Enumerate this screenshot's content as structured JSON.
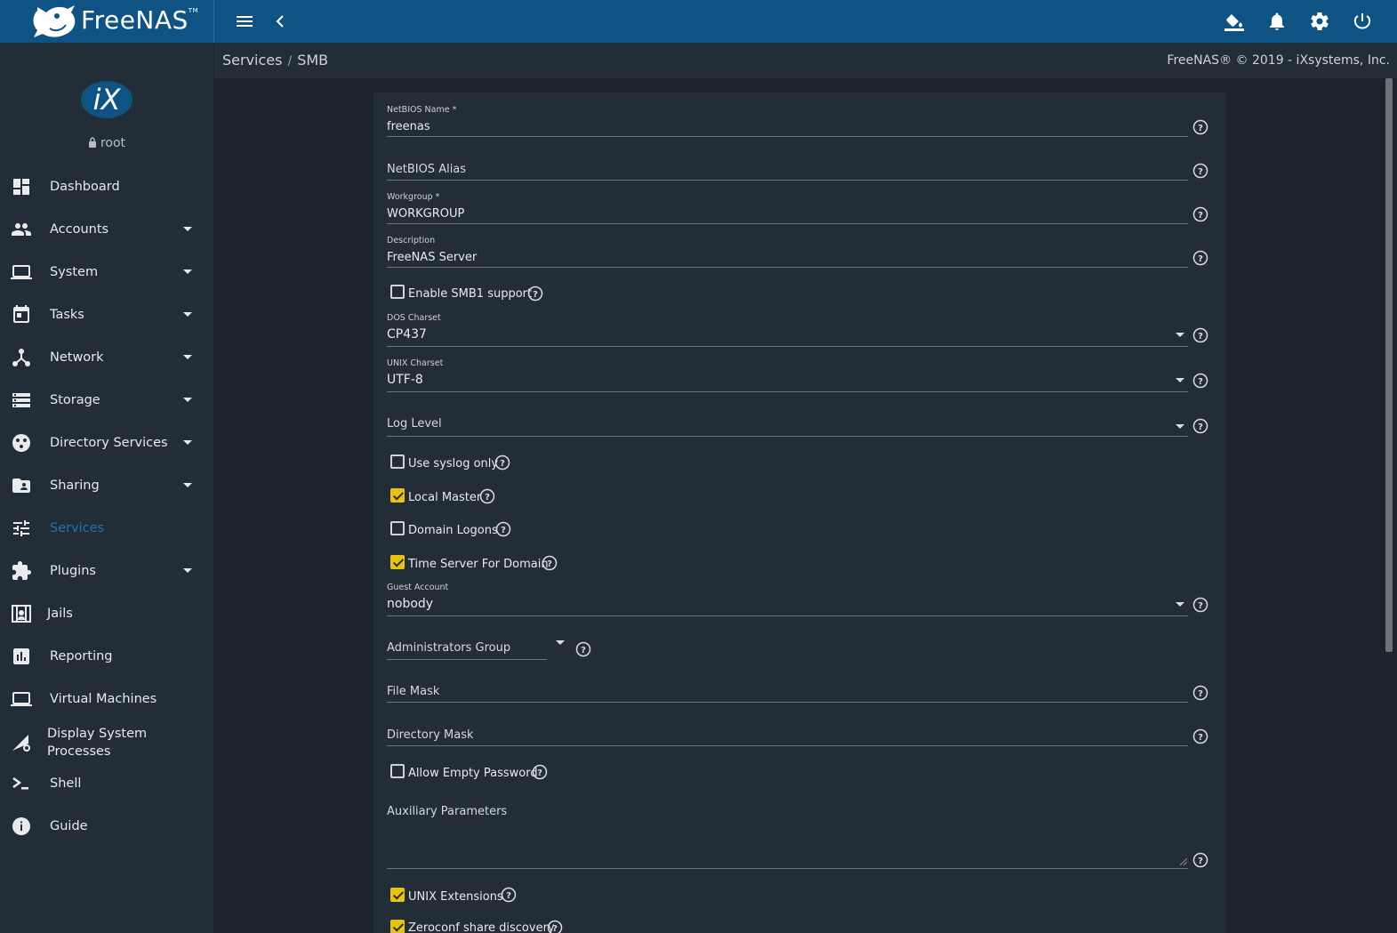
{
  "app": {
    "brand": "FreeNAS",
    "trademark": "TM",
    "user": "root",
    "copyright": "FreeNAS® © 2019 - iXsystems, Inc."
  },
  "breadcrumb": [
    "Services",
    "SMB"
  ],
  "breadcrumb_sep": "/",
  "topbar_icons": [
    "menu-icon",
    "chevron-left-icon",
    "theme-bucket-icon",
    "bell-icon",
    "gear-icon",
    "power-icon"
  ],
  "sidebar": {
    "items": [
      {
        "label": "Dashboard",
        "icon": "dashboard-icon",
        "expandable": false
      },
      {
        "label": "Accounts",
        "icon": "people-icon",
        "expandable": true
      },
      {
        "label": "System",
        "icon": "laptop-icon",
        "expandable": true
      },
      {
        "label": "Tasks",
        "icon": "calendar-icon",
        "expandable": true
      },
      {
        "label": "Network",
        "icon": "network-icon",
        "expandable": true
      },
      {
        "label": "Storage",
        "icon": "storage-icon",
        "expandable": true
      },
      {
        "label": "Directory Services",
        "icon": "directory-icon",
        "expandable": true
      },
      {
        "label": "Sharing",
        "icon": "sharing-folder-icon",
        "expandable": true
      },
      {
        "label": "Services",
        "icon": "tune-icon",
        "expandable": false,
        "active": true
      },
      {
        "label": "Plugins",
        "icon": "puzzle-icon",
        "expandable": true
      },
      {
        "label": "Jails",
        "icon": "jail-icon",
        "expandable": false
      },
      {
        "label": "Reporting",
        "icon": "chart-icon",
        "expandable": false
      },
      {
        "label": "Virtual Machines",
        "icon": "laptop-icon",
        "expandable": false
      },
      {
        "label": "Display System Processes",
        "icon": "processes-icon",
        "expandable": false
      },
      {
        "label": "Shell",
        "icon": "terminal-icon",
        "expandable": false
      },
      {
        "label": "Guide",
        "icon": "info-icon",
        "expandable": false
      }
    ],
    "label_lines": {
      "display_1": "Display System",
      "display_2": "Processes"
    }
  },
  "form": {
    "netbios_name": {
      "label": "NetBIOS Name *",
      "value": "freenas"
    },
    "netbios_alias": {
      "placeholder": "NetBIOS Alias",
      "value": ""
    },
    "workgroup": {
      "label": "Workgroup *",
      "value": "WORKGROUP"
    },
    "description": {
      "label": "Description",
      "value": "FreeNAS Server"
    },
    "enable_smb1": {
      "label": "Enable SMB1 support",
      "checked": false
    },
    "dos_charset": {
      "label": "DOS Charset",
      "value": "CP437"
    },
    "unix_charset": {
      "label": "UNIX Charset",
      "value": "UTF-8"
    },
    "log_level": {
      "placeholder": "Log Level",
      "value": ""
    },
    "use_syslog": {
      "label": "Use syslog only",
      "checked": false
    },
    "local_master": {
      "label": "Local Master",
      "checked": true
    },
    "domain_logons": {
      "label": "Domain Logons",
      "checked": false
    },
    "time_server": {
      "label": "Time Server For Domain",
      "checked": true
    },
    "guest_account": {
      "label": "Guest Account",
      "value": "nobody"
    },
    "admin_group": {
      "placeholder": "Administrators Group",
      "value": ""
    },
    "file_mask": {
      "placeholder": "File Mask",
      "value": ""
    },
    "directory_mask": {
      "placeholder": "Directory Mask",
      "value": ""
    },
    "allow_empty_password": {
      "label": "Allow Empty Password",
      "checked": false
    },
    "aux_params": {
      "placeholder": "Auxiliary Parameters",
      "value": ""
    },
    "unix_extensions": {
      "label": "UNIX Extensions",
      "checked": true
    },
    "zeroconf": {
      "label": "Zeroconf share discovery",
      "checked": true
    }
  },
  "colors": {
    "topbar": "#0e5384",
    "sidebar": "#232d38",
    "background": "#1c242e",
    "active_nav": "#1a75b7",
    "checkbox_on": "#e8c20d"
  }
}
